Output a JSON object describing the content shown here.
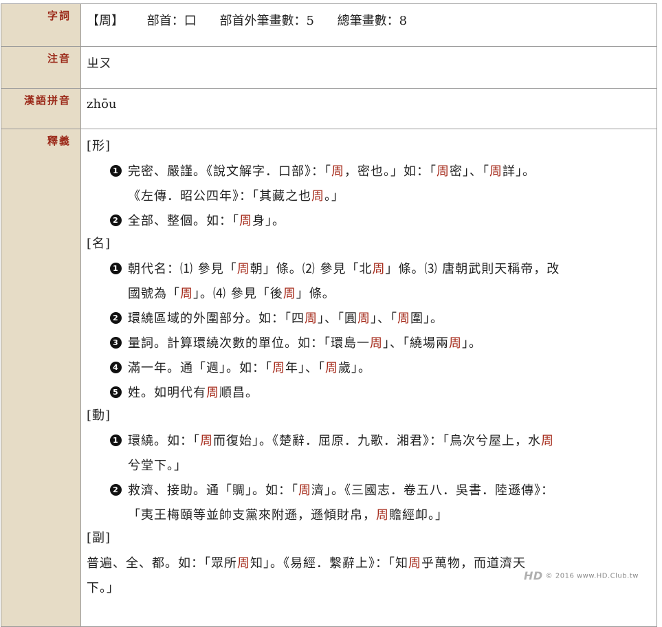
{
  "labels": {
    "zici": "字詞",
    "zhuyin": "注音",
    "pinyin_label": "漢語拼音",
    "shiyi": "釋義"
  },
  "entry": {
    "char": "【周】",
    "radical": "部首：口",
    "stroke_outside": "部首外筆畫數：5",
    "stroke_total": "總筆畫數：8",
    "zhuyin": "ㄓㄡ",
    "pinyin": "zhōu"
  },
  "pos_labels": {
    "xing": "[形]",
    "ming": "[名]",
    "dong": "[動]",
    "fu": "[副]"
  },
  "numbers": [
    "1",
    "2",
    "3",
    "4",
    "5"
  ],
  "xing": [
    {
      "line1": [
        "完密、嚴謹。《說文解字．口部》：「",
        "周",
        "，密也。」如：「",
        "周",
        "密」、「",
        "周",
        "詳」。"
      ],
      "line2": [
        "《左傳．昭公四年》：「其藏之也",
        "周",
        "。」"
      ]
    },
    {
      "line1": [
        "全部、整個。如：「",
        "周",
        "身」。"
      ]
    }
  ],
  "ming": [
    {
      "line1": [
        "朝代名：⑴ 參見「",
        "周",
        "朝」條。⑵ 參見「北",
        "周",
        "」條。⑶ 唐朝武則天稱帝，改"
      ],
      "line2": [
        "國號為「",
        "周",
        "」。⑷ 參見「後",
        "周",
        "」條。"
      ]
    },
    {
      "line1": [
        "環繞區域的外圍部分。如：「四",
        "周",
        "」、「圓",
        "周",
        "」、「",
        "周",
        "圍」。"
      ]
    },
    {
      "line1": [
        "量詞。計算環繞次數的單位。如：「環島一",
        "周",
        "」、「繞場兩",
        "周",
        "」。"
      ]
    },
    {
      "line1": [
        "滿一年。通「週」。如：「",
        "周",
        "年」、「",
        "周",
        "歲」。"
      ]
    },
    {
      "line1": [
        "姓。如明代有",
        "周",
        "順昌。"
      ]
    }
  ],
  "dong": [
    {
      "line1": [
        "環繞。如：「",
        "周",
        "而復始」。《楚辭．屈原．九歌．湘君》：「鳥次兮屋上，水",
        "周"
      ],
      "line2": [
        "兮堂下。」"
      ]
    },
    {
      "line1": [
        "救濟、接助。通「賙」。如：「",
        "周",
        "濟」。《三國志．卷五八．吳書．陸遜傳》："
      ],
      "line2": [
        "「夷王梅頤等並帥支黨來附遜，遜傾財帛，",
        "周",
        "贍經卹。」"
      ]
    }
  ],
  "fu": {
    "line1": [
      "普遍、全、都。如：「眾所",
      "周",
      "知」。《易經．繫辭上》：「知",
      "周",
      "乎萬物，而道濟天"
    ],
    "line2": [
      "下。」"
    ]
  },
  "watermark": {
    "logo": "HD",
    "text": "© 2016 www.HD.Club.tw"
  },
  "colors": {
    "label_bg": "#e6dcc6",
    "label_text": "#9b2a1a",
    "highlight": "#a52a1a"
  }
}
